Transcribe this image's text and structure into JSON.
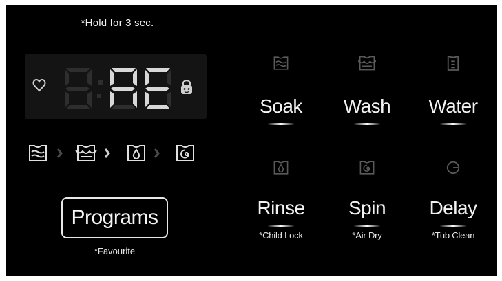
{
  "hold_note": "*Hold for 3 sec.",
  "display": {
    "readout": "1:AE",
    "icons": [
      "heart-icon",
      "lock-icon"
    ]
  },
  "cycle_icons": [
    "soak-cycle-icon",
    "wash-cycle-icon",
    "rinse-cycle-icon",
    "spin-cycle-icon"
  ],
  "programs": {
    "label": "Programs",
    "sub": "*Favourite"
  },
  "functions": [
    {
      "label": "Soak",
      "sub": "",
      "icon": "soak-icon"
    },
    {
      "label": "Wash",
      "sub": "",
      "icon": "wash-icon"
    },
    {
      "label": "Water",
      "sub": "",
      "icon": "water-level-icon"
    },
    {
      "label": "Rinse",
      "sub": "*Child Lock",
      "icon": "rinse-icon"
    },
    {
      "label": "Spin",
      "sub": "*Air Dry",
      "icon": "spin-icon"
    },
    {
      "label": "Delay",
      "sub": "*Tub Clean",
      "icon": "delay-timer-icon"
    }
  ],
  "colors": {
    "background": "#000000",
    "text": "#f2f2f2",
    "display_bg": "#141414",
    "segment_on": "#d8d8d8",
    "segment_off": "#2e2e2e",
    "icon_dim": "#5a5a5a"
  }
}
